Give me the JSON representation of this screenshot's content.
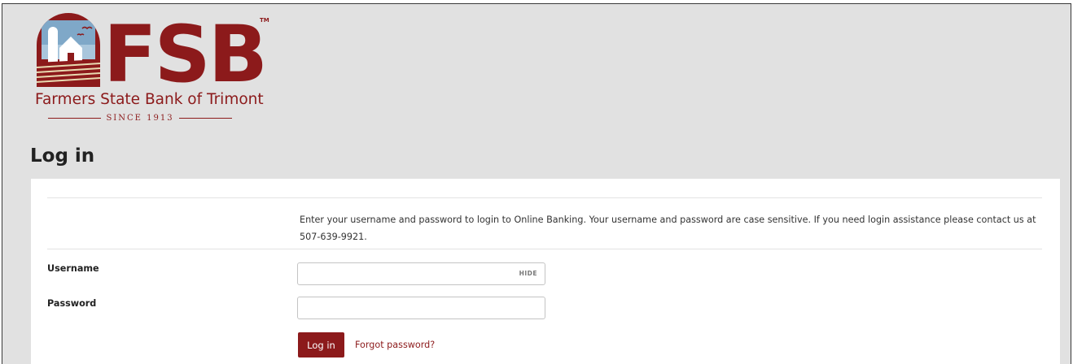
{
  "brand": {
    "short_name": "FSB",
    "trademark": "TM",
    "full_name": "Farmers State Bank of Trimont",
    "since": "SINCE 1913",
    "color": "#8c1a1b"
  },
  "page": {
    "title": "Log in"
  },
  "login": {
    "intro": "Enter your username and password to login to Online Banking. Your username and password are case sensitive. If you need login assistance please contact us at 507-639-9921.",
    "username_label": "Username",
    "username_value": "",
    "password_label": "Password",
    "password_value": "",
    "hide_label": "HIDE",
    "submit_label": "Log in",
    "forgot_label": "Forgot password?"
  }
}
